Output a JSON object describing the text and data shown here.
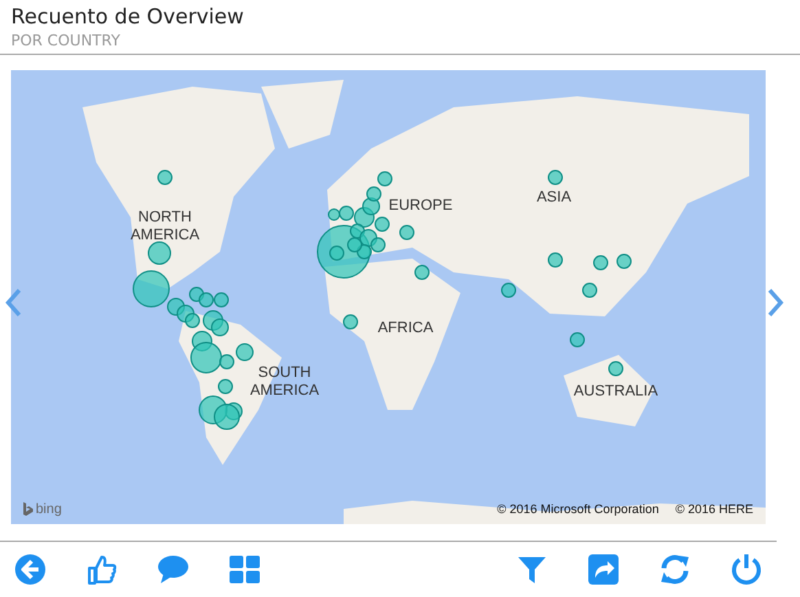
{
  "header": {
    "title": "Recuento de Overview",
    "subtitle": "POR COUNTRY"
  },
  "map": {
    "labels": [
      {
        "text": "NORTH AMERICA"
      },
      {
        "text": "EUROPE"
      },
      {
        "text": "ASIA"
      },
      {
        "text": "AFRICA"
      },
      {
        "text": "SOUTH AMERICA"
      },
      {
        "text": "AUSTRALIA"
      }
    ],
    "logo": "bing",
    "credits": [
      "© 2016 Microsoft Corporation",
      "© 2016 HERE"
    ]
  },
  "toolbar": {
    "left": [
      {
        "kind": "back"
      },
      {
        "kind": "like"
      },
      {
        "kind": "comment"
      },
      {
        "kind": "tiles"
      }
    ],
    "right": [
      {
        "kind": "filter"
      },
      {
        "kind": "share"
      },
      {
        "kind": "refresh"
      },
      {
        "kind": "power"
      }
    ]
  }
}
